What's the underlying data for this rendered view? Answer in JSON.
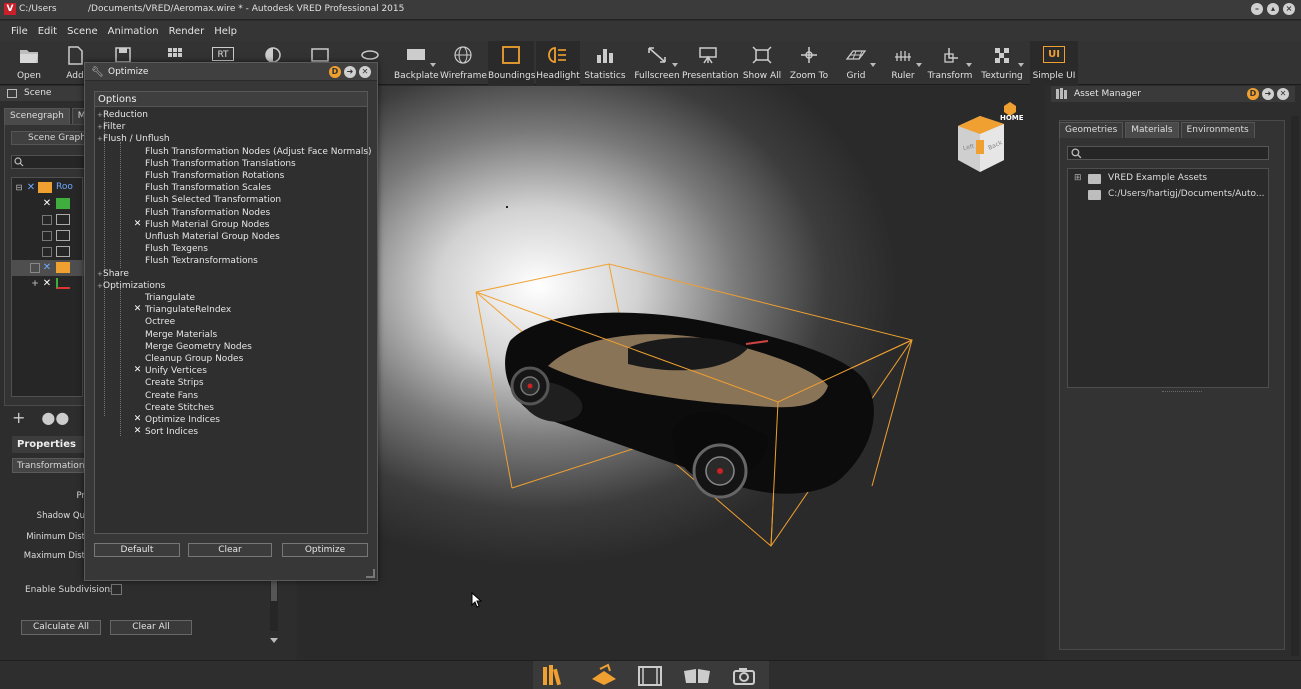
{
  "window": {
    "title": "C:/Users           /Documents/VRED/Aeromax.wire * - Autodesk VRED Professional 2015",
    "app_icon": "V"
  },
  "menu": [
    "File",
    "Edit",
    "Scene",
    "Animation",
    "Render",
    "Help"
  ],
  "toolbar": {
    "open": "Open",
    "add": "Add",
    "backplate": "Backplate",
    "wireframe": "Wireframe",
    "boundings": "Boundings",
    "headlight": "Headlight",
    "statistics": "Statistics",
    "fullscreen": "Fullscreen",
    "presentation": "Presentation",
    "show_all": "Show All",
    "zoom_to": "Zoom To",
    "grid": "Grid",
    "ruler": "Ruler",
    "transform": "Transform",
    "texturing": "Texturing",
    "simple_ui": "Simple UI",
    "rt_badge": "RT",
    "ui_badge": "UI",
    "accent_color": "#f0a030"
  },
  "scene_panel": {
    "title": "Scene",
    "tabs": [
      "Scenegraph",
      "Mate"
    ],
    "scene_graph_btn": "Scene Graph",
    "root_label": "Roo"
  },
  "properties": {
    "title": "Properties",
    "tab": "Transformation",
    "labels": [
      "Pr",
      "Shadow Qu",
      "Minimum Dist",
      "Maximum Dist"
    ],
    "enable_subdivisions": "Enable Subdivisions",
    "calculate_all": "Calculate All",
    "clear_all": "Clear All"
  },
  "optimize": {
    "title": "Optimize",
    "options_header": "Options",
    "groups": {
      "reduction": "Reduction",
      "filter": "Filter",
      "flush": "Flush / Unflush",
      "share": "Share",
      "optimizations": "Optimizations"
    },
    "flush_items": [
      {
        "label": "Flush Transformation Nodes (Adjust Face Normals)",
        "checked": false
      },
      {
        "label": "Flush Transformation Translations",
        "checked": false
      },
      {
        "label": "Flush Transformation Rotations",
        "checked": false
      },
      {
        "label": "Flush Transformation Scales",
        "checked": false
      },
      {
        "label": "Flush Selected Transformation",
        "checked": false
      },
      {
        "label": "Flush Transformation Nodes",
        "checked": false
      },
      {
        "label": "Flush Material Group Nodes",
        "checked": true
      },
      {
        "label": "Unflush Material Group Nodes",
        "checked": false
      },
      {
        "label": "Flush Texgens",
        "checked": false
      },
      {
        "label": "Flush Textransformations",
        "checked": false
      }
    ],
    "opt_items": [
      {
        "label": "Triangulate",
        "checked": false
      },
      {
        "label": "TriangulateReIndex",
        "checked": true
      },
      {
        "label": "Octree",
        "checked": false
      },
      {
        "label": "Merge Materials",
        "checked": false
      },
      {
        "label": "Merge Geometry Nodes",
        "checked": false
      },
      {
        "label": "Cleanup Group Nodes",
        "checked": false
      },
      {
        "label": "Unify Vertices",
        "checked": true
      },
      {
        "label": "Create Strips",
        "checked": false
      },
      {
        "label": "Create Fans",
        "checked": false
      },
      {
        "label": "Create Stitches",
        "checked": false
      },
      {
        "label": "Optimize Indices",
        "checked": true
      },
      {
        "label": "Sort Indices",
        "checked": true
      }
    ],
    "buttons": {
      "default": "Default",
      "clear": "Clear",
      "optimize": "Optimize"
    },
    "title_badge": "D"
  },
  "viewport": {
    "navcube": {
      "home": "HOME",
      "left": "Left",
      "back": "Back"
    },
    "bbox_color": "#f0a030"
  },
  "asset_manager": {
    "title": "Asset Manager",
    "tabs": [
      "Geometries",
      "Materials",
      "Environments"
    ],
    "selected_tab": "Materials",
    "items": [
      "VRED Example Assets",
      "C:/Users/hartigj/Documents/Auto..."
    ],
    "title_badge": "D"
  },
  "dock": [
    "assets-icon",
    "render-icon",
    "film-icon",
    "cards-icon",
    "camera-icon"
  ]
}
